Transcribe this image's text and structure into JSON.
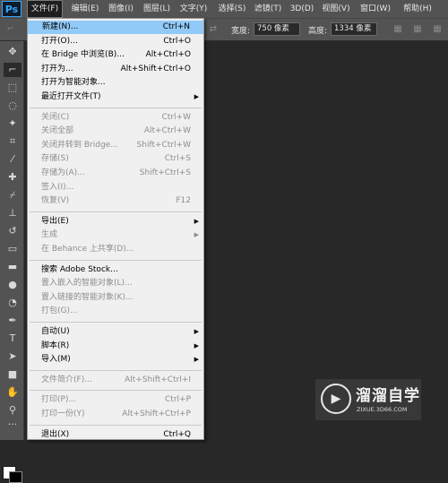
{
  "app": {
    "logo": "Ps"
  },
  "menubar": [
    {
      "label": "文件(F)",
      "active": true
    },
    {
      "label": "编辑(E)"
    },
    {
      "label": "图像(I)"
    },
    {
      "label": "图层(L)"
    },
    {
      "label": "文字(Y)"
    },
    {
      "label": "选择(S)"
    },
    {
      "label": "滤镜(T)"
    },
    {
      "label": "3D(D)"
    },
    {
      "label": "视图(V)"
    },
    {
      "label": "窗口(W)"
    },
    {
      "label": "帮助(H)"
    }
  ],
  "options": {
    "width_label": "宽度:",
    "width_value": "750 像素",
    "height_label": "高度:",
    "height_value": "1334 像素"
  },
  "file_menu": {
    "groups": [
      [
        {
          "label": "新建(N)...",
          "shortcut": "Ctrl+N",
          "highlighted": true
        },
        {
          "label": "打开(O)...",
          "shortcut": "Ctrl+O"
        },
        {
          "label": "在 Bridge 中浏览(B)...",
          "shortcut": "Alt+Ctrl+O"
        },
        {
          "label": "打开为...",
          "shortcut": "Alt+Shift+Ctrl+O"
        },
        {
          "label": "打开为智能对象..."
        },
        {
          "label": "最近打开文件(T)",
          "submenu": true
        }
      ],
      [
        {
          "label": "关闭(C)",
          "shortcut": "Ctrl+W",
          "disabled": true
        },
        {
          "label": "关闭全部",
          "shortcut": "Alt+Ctrl+W",
          "disabled": true
        },
        {
          "label": "关闭并转到 Bridge...",
          "shortcut": "Shift+Ctrl+W",
          "disabled": true
        },
        {
          "label": "存储(S)",
          "shortcut": "Ctrl+S",
          "disabled": true
        },
        {
          "label": "存储为(A)...",
          "shortcut": "Shift+Ctrl+S",
          "disabled": true
        },
        {
          "label": "签入(I)...",
          "disabled": true
        },
        {
          "label": "恢复(V)",
          "shortcut": "F12",
          "disabled": true
        }
      ],
      [
        {
          "label": "导出(E)",
          "submenu": true
        },
        {
          "label": "生成",
          "submenu": true,
          "disabled": true
        },
        {
          "label": "在 Behance 上共享(D)...",
          "disabled": true
        }
      ],
      [
        {
          "label": "搜索 Adobe Stock..."
        },
        {
          "label": "置入嵌入的智能对象(L)...",
          "disabled": true
        },
        {
          "label": "置入链接的智能对象(K)...",
          "disabled": true
        },
        {
          "label": "打包(G)...",
          "disabled": true
        }
      ],
      [
        {
          "label": "自动(U)",
          "submenu": true
        },
        {
          "label": "脚本(R)",
          "submenu": true
        },
        {
          "label": "导入(M)",
          "submenu": true
        }
      ],
      [
        {
          "label": "文件简介(F)...",
          "shortcut": "Alt+Shift+Ctrl+I",
          "disabled": true
        }
      ],
      [
        {
          "label": "打印(P)...",
          "shortcut": "Ctrl+P",
          "disabled": true
        },
        {
          "label": "打印一份(Y)",
          "shortcut": "Alt+Shift+Ctrl+P",
          "disabled": true
        }
      ],
      [
        {
          "label": "退出(X)",
          "shortcut": "Ctrl+Q"
        }
      ]
    ]
  },
  "watermark": {
    "title": "溜溜自学",
    "url": "ZIXUE.3D66.COM"
  }
}
